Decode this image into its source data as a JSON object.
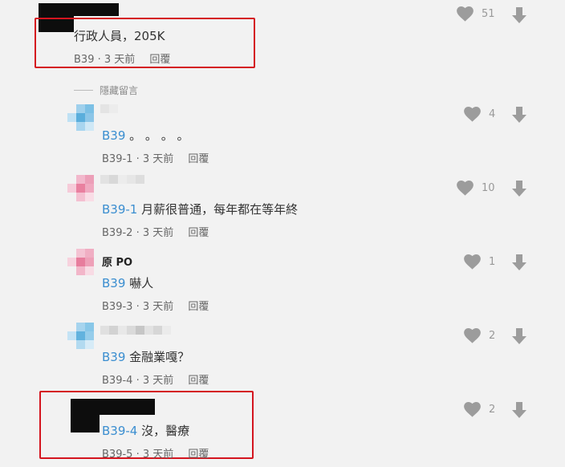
{
  "colors": {
    "accent": "#3b8ed0",
    "highlight": "#d4151f",
    "icon": "#9c9c9c"
  },
  "hide_comments_label": "隱藏留言",
  "reply_label": "回覆",
  "top_comment": {
    "text": "行政人員，205K",
    "floor": "B39",
    "time": "3 天前",
    "likes": "51"
  },
  "replies": [
    {
      "author": "",
      "mention": "B39",
      "text": " 。 。 。 。",
      "floor": "B39-1",
      "time": "3 天前",
      "likes": "4"
    },
    {
      "author": "",
      "mention": "B39-1",
      "text": " 月薪很普通，每年都在等年終",
      "floor": "B39-2",
      "time": "3 天前",
      "likes": "10"
    },
    {
      "author": "原 PO",
      "mention": "B39",
      "text": " 嚇人",
      "floor": "B39-3",
      "time": "3 天前",
      "likes": "1"
    },
    {
      "author": "",
      "mention": "B39",
      "text": " 金融業嘎？",
      "floor": "B39-4",
      "time": "3 天前",
      "likes": "2"
    },
    {
      "author": "",
      "mention": "B39-4",
      "text": " 沒，醫療",
      "floor": "B39-5",
      "time": "3 天前",
      "likes": "2"
    }
  ]
}
